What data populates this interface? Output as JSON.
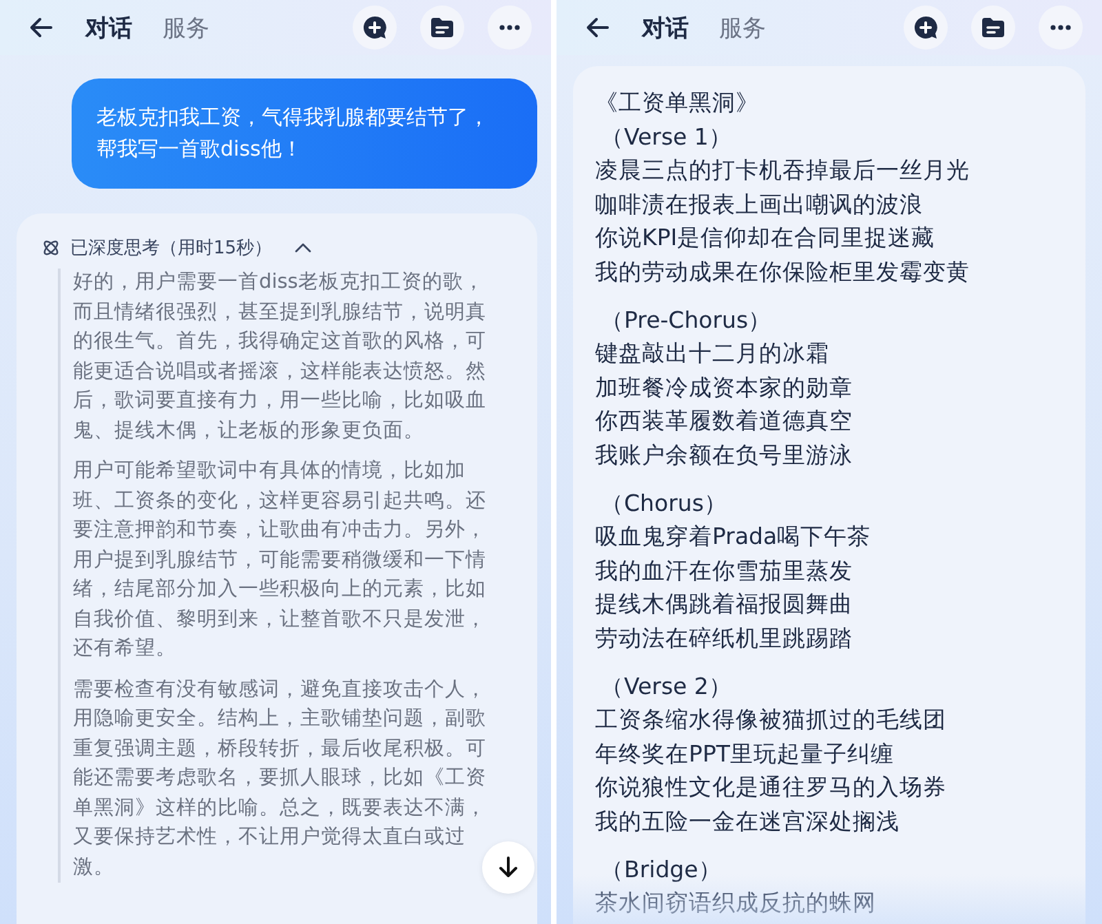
{
  "screens": [
    {
      "header": {
        "tabs": [
          {
            "label": "对话",
            "selected": true
          },
          {
            "label": "服务",
            "selected": false
          }
        ]
      },
      "user_message": "老板克扣我工资，气得我乳腺都要结节了，帮我写一首歌diss他！",
      "thinking": {
        "label": "已深度思考（用时15秒）",
        "expanded": true,
        "paragraphs": [
          "好的，用户需要一首diss老板克扣工资的歌，而且情绪很强烈，甚至提到乳腺结节，说明真的很生气。首先，我得确定这首歌的风格，可能更适合说唱或者摇滚，这样能表达愤怒。然后，歌词要直接有力，用一些比喻，比如吸血鬼、提线木偶，让老板的形象更负面。",
          "用户可能希望歌词中有具体的情境，比如加班、工资条的变化，这样更容易引起共鸣。还要注意押韵和节奏，让歌曲有冲击力。另外，用户提到乳腺结节，可能需要稍微缓和一下情绪，结尾部分加入一些积极向上的元素，比如自我价值、黎明到来，让整首歌不只是发泄，还有希望。",
          "需要检查有没有敏感词，避免直接攻击个人，用隐喻更安全。结构上，主歌铺垫问题，副歌重复强调主题，桥段转折，最后收尾积极。可能还需要考虑歌名，要抓人眼球，比如《工资单黑洞》这样的比喻。总之，既要表达不满，又要保持艺术性，不让用户觉得太直白或过激。"
        ]
      }
    },
    {
      "header": {
        "tabs": [
          {
            "label": "对话",
            "selected": true
          },
          {
            "label": "服务",
            "selected": false
          }
        ]
      },
      "lyrics": {
        "title": "《工资单黑洞》",
        "sections": [
          {
            "heading": "（Verse 1）",
            "lines": [
              "凌晨三点的打卡机吞掉最后一丝月光",
              "咖啡渍在报表上画出嘲讽的波浪",
              "你说KPI是信仰却在合同里捉迷藏",
              "我的劳动成果在你保险柜里发霉变黄"
            ]
          },
          {
            "heading": "（Pre-Chorus）",
            "lines": [
              "键盘敲出十二月的冰霜",
              "加班餐冷成资本家的勋章",
              "你西装革履数着道德真空",
              "我账户余额在负号里游泳"
            ]
          },
          {
            "heading": "（Chorus）",
            "lines": [
              "吸血鬼穿着Prada喝下午茶",
              "我的血汗在你雪茄里蒸发",
              "提线木偶跳着福报圆舞曲",
              "劳动法在碎纸机里跳踢踏"
            ]
          },
          {
            "heading": "（Verse 2）",
            "lines": [
              "工资条缩水得像被猫抓过的毛线团",
              "年终奖在PPT里玩起量子纠缠",
              "你说狼性文化是通往罗马的入场券",
              "我的五险一金在迷宫深处搁浅"
            ]
          },
          {
            "heading": "（Bridge）",
            "lines": [
              "茶水间窃语织成反抗的蛛网"
            ]
          }
        ]
      }
    }
  ]
}
